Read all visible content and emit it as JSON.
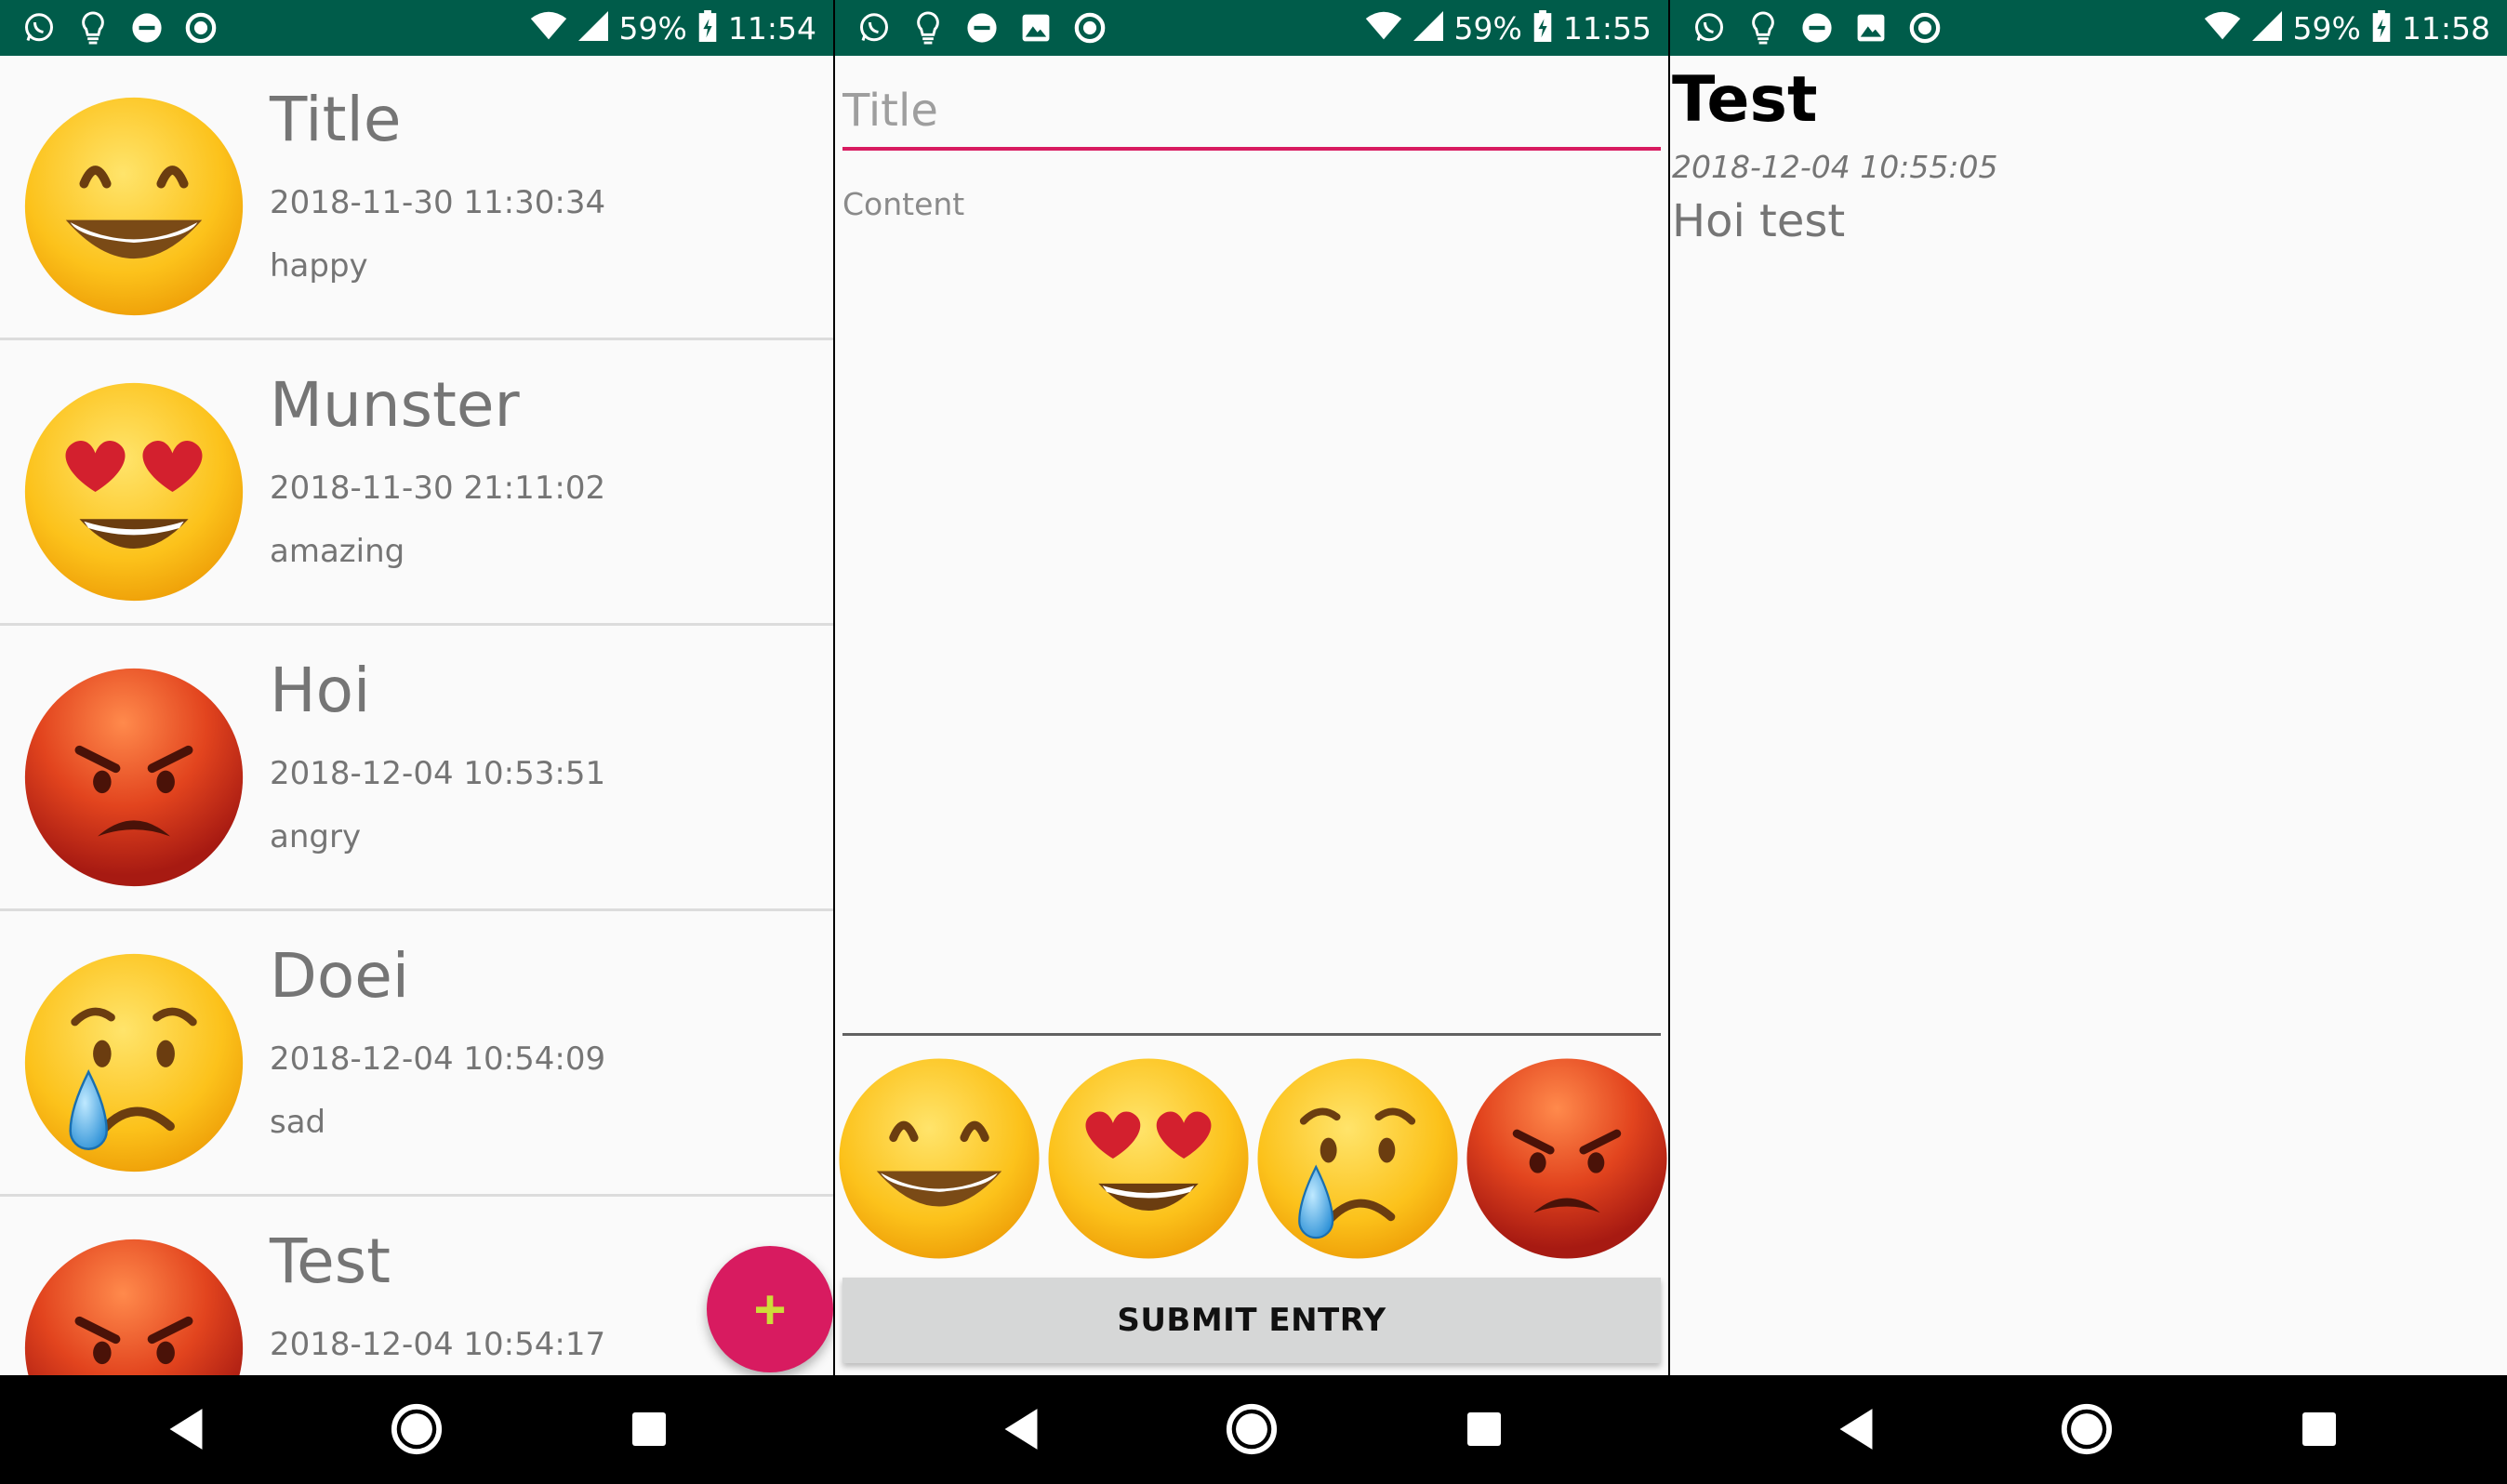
{
  "screens": [
    {
      "status": {
        "battery": "59%",
        "time": "11:54"
      },
      "entries": [
        {
          "title": "Title",
          "date": "2018-11-30 11:30:34",
          "mood": "happy"
        },
        {
          "title": "Munster",
          "date": "2018-11-30 21:11:02",
          "mood": "amazing"
        },
        {
          "title": "Hoi",
          "date": "2018-12-04 10:53:51",
          "mood": "angry"
        },
        {
          "title": "Doei",
          "date": "2018-12-04 10:54:09",
          "mood": "sad"
        },
        {
          "title": "Test",
          "date": "2018-12-04 10:54:17",
          "mood": "angry"
        }
      ],
      "fab_label": "+"
    },
    {
      "status": {
        "battery": "59%",
        "time": "11:55"
      },
      "title_placeholder": "Title",
      "content_placeholder": "Content",
      "mood_options": [
        "happy",
        "amazing",
        "sad",
        "angry"
      ],
      "submit_label": "SUBMIT ENTRY"
    },
    {
      "status": {
        "battery": "59%",
        "time": "11:58"
      },
      "title": "Test",
      "date": "2018-12-04 10:55:05",
      "content": "Hoi test"
    }
  ],
  "colors": {
    "status_bar": "#005c4a",
    "accent": "#d81b60",
    "fab_icon": "#cddc39",
    "secondary_text": "#757575"
  },
  "icons": {
    "status_left": [
      "whatsapp-icon",
      "lightbulb-icon",
      "do-not-disturb-icon",
      "image-icon",
      "circle-app-icon"
    ],
    "status_right": [
      "wifi-icon",
      "signal-icon",
      "battery-charging-icon"
    ],
    "nav": [
      "back-icon",
      "home-icon",
      "recents-icon"
    ]
  }
}
